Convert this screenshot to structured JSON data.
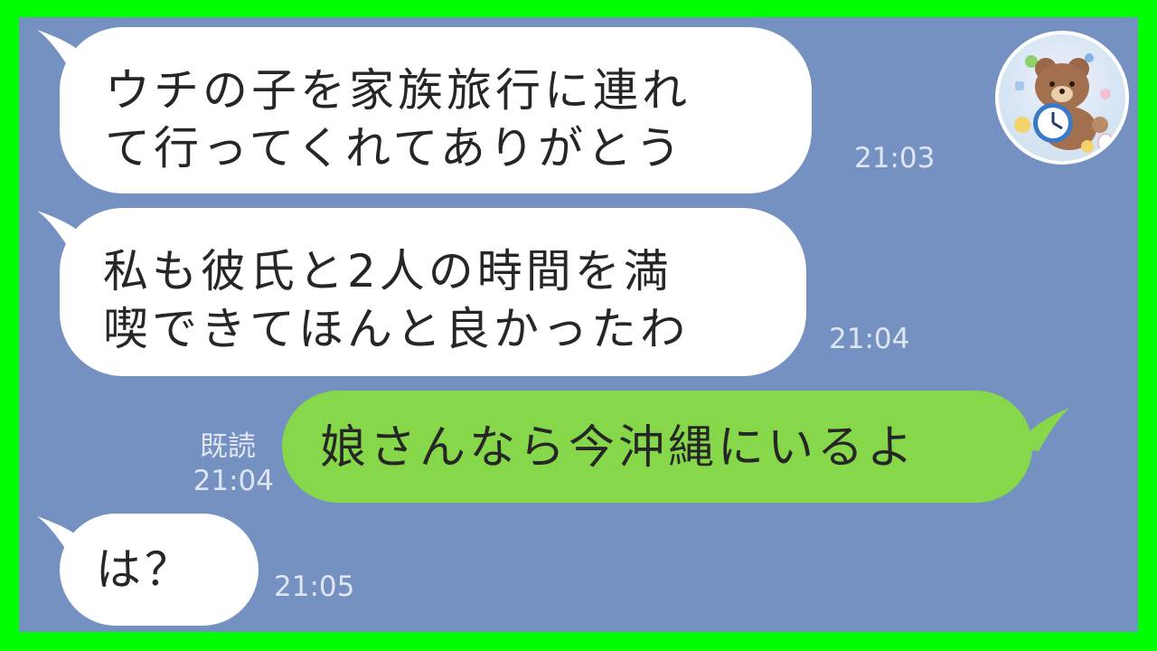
{
  "chat": {
    "messages": [
      {
        "id": "m1",
        "side": "incoming",
        "text": "ウチの子を家族旅行に連れ\nて行ってくれてありがとう",
        "time": "21:03"
      },
      {
        "id": "m2",
        "side": "incoming",
        "text": "私も彼氏と2人の時間を満\n喫できてほんと良かったわ",
        "time": "21:04"
      },
      {
        "id": "m3",
        "side": "outgoing",
        "text": "娘さんなら今沖縄にいるよ",
        "read_label": "既読",
        "time": "21:04"
      },
      {
        "id": "m4",
        "side": "incoming",
        "text": "は？",
        "time": "21:05"
      }
    ],
    "avatar_icon": "bear-clock-avatar-icon"
  },
  "colors": {
    "frame": "#00ff00",
    "chat_background": "#7491c2",
    "incoming_bubble": "#ffffff",
    "outgoing_bubble": "#86d84a",
    "meta_text": "#dfe6f2"
  }
}
